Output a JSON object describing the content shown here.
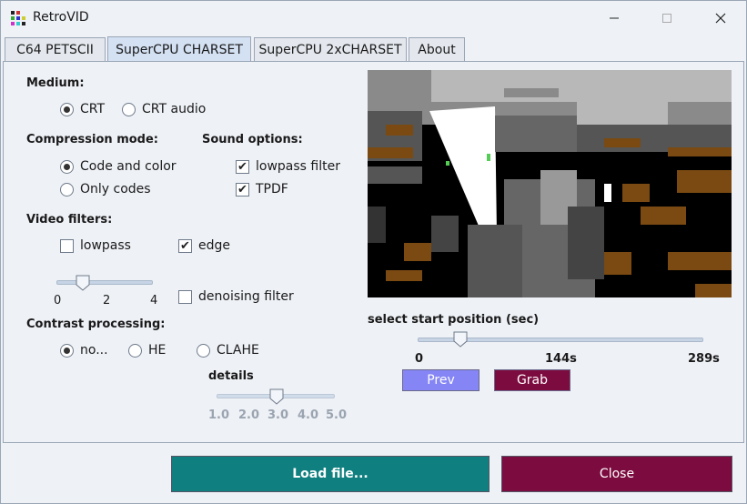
{
  "window": {
    "title": "RetroVID"
  },
  "tabs": [
    {
      "label": "C64 PETSCII",
      "active": false
    },
    {
      "label": "SuperCPU CHARSET",
      "active": true
    },
    {
      "label": "SuperCPU 2xCHARSET",
      "active": false
    },
    {
      "label": "About",
      "active": false
    }
  ],
  "medium": {
    "label": "Medium:",
    "options": [
      {
        "label": "CRT",
        "selected": true
      },
      {
        "label": "CRT audio",
        "selected": false
      }
    ]
  },
  "compression": {
    "label": "Compression mode:",
    "options": [
      {
        "label": "Code and color",
        "selected": true
      },
      {
        "label": "Only codes",
        "selected": false
      }
    ]
  },
  "sound": {
    "label": "Sound options:",
    "options": [
      {
        "label": "lowpass filter",
        "checked": true
      },
      {
        "label": "TPDF",
        "checked": true
      }
    ]
  },
  "video_filters": {
    "label": "Video filters:",
    "lowpass": {
      "label": "lowpass",
      "checked": false
    },
    "edge": {
      "label": "edge",
      "checked": true
    },
    "denoise": {
      "label": "denoising filter",
      "checked": false
    },
    "lowpass_slider": {
      "ticks": [
        "0",
        "2",
        "4"
      ],
      "value": 1,
      "min": 0,
      "max": 4
    }
  },
  "contrast": {
    "label": "Contrast processing:",
    "options": [
      {
        "label": "no...",
        "selected": true
      },
      {
        "label": "HE",
        "selected": false
      },
      {
        "label": "CLAHE",
        "selected": false
      }
    ],
    "details": {
      "label": "details",
      "ticks": [
        "1.0",
        "2.0",
        "3.0",
        "4.0",
        "5.0"
      ],
      "value": 3.0,
      "min": 1.0,
      "max": 5.0
    }
  },
  "position": {
    "label": "select start position (sec)",
    "ticks": [
      "0",
      "144s",
      "289s"
    ],
    "value_fraction": 0.15
  },
  "buttons": {
    "prev": "Prev",
    "grab": "Grab",
    "load": "Load file...",
    "close": "Close"
  },
  "colors": {
    "prev": "#8585f5",
    "grab": "#7c0b3f",
    "load": "#0f7f7f",
    "close": "#7c0b3f",
    "preview_brown": "#7a4a12"
  }
}
